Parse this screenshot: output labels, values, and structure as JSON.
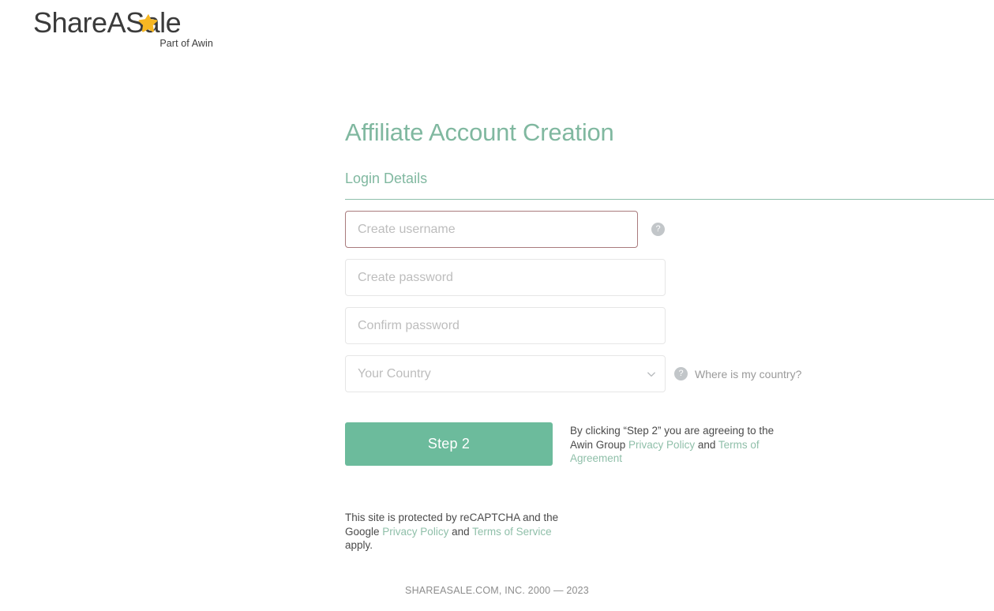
{
  "brand": {
    "wordmark": "ShareASale",
    "tagline": "Part of Awin",
    "star_icon": "star-icon",
    "star_color": "#f6b723",
    "wordmark_color": "#3b3b3b"
  },
  "colors": {
    "accent_green": "#80b8a0",
    "button_green": "#6cbb9c",
    "link_green": "#8fbfa9",
    "error_border": "#a97b7d",
    "field_border": "#e6e6e6",
    "placeholder": "#bdbdbd",
    "help_icon_bg": "#c2c6c9"
  },
  "page": {
    "title": "Affiliate Account Creation",
    "section_title": "Login Details"
  },
  "form": {
    "username": {
      "placeholder": "Create username",
      "value": "",
      "state": "error",
      "help_icon": "question-mark-icon"
    },
    "password": {
      "placeholder": "Create password",
      "value": ""
    },
    "confirm_password": {
      "placeholder": "Confirm password",
      "value": ""
    },
    "country": {
      "placeholder": "Your Country",
      "selected": "Your Country",
      "options": [
        "Your Country"
      ],
      "chevron_icon": "chevron-down-icon",
      "help_icon": "question-mark-icon",
      "help_label": "Where is my country?"
    },
    "submit_label": "Step 2"
  },
  "agreement": {
    "prefix": "By clicking “Step 2” you are agreeing to the Awin Group ",
    "privacy_policy": "Privacy Policy",
    "conjunction": " and ",
    "terms": "Terms of Agreement"
  },
  "recaptcha": {
    "prefix": "This site is protected by reCAPTCHA and the Google ",
    "privacy_policy": "Privacy Policy",
    "conjunction": " and ",
    "terms": "Terms of Service",
    "suffix": " apply."
  },
  "footer": {
    "copyright": "SHAREASALE.COM, INC. 2000 — 2023"
  }
}
